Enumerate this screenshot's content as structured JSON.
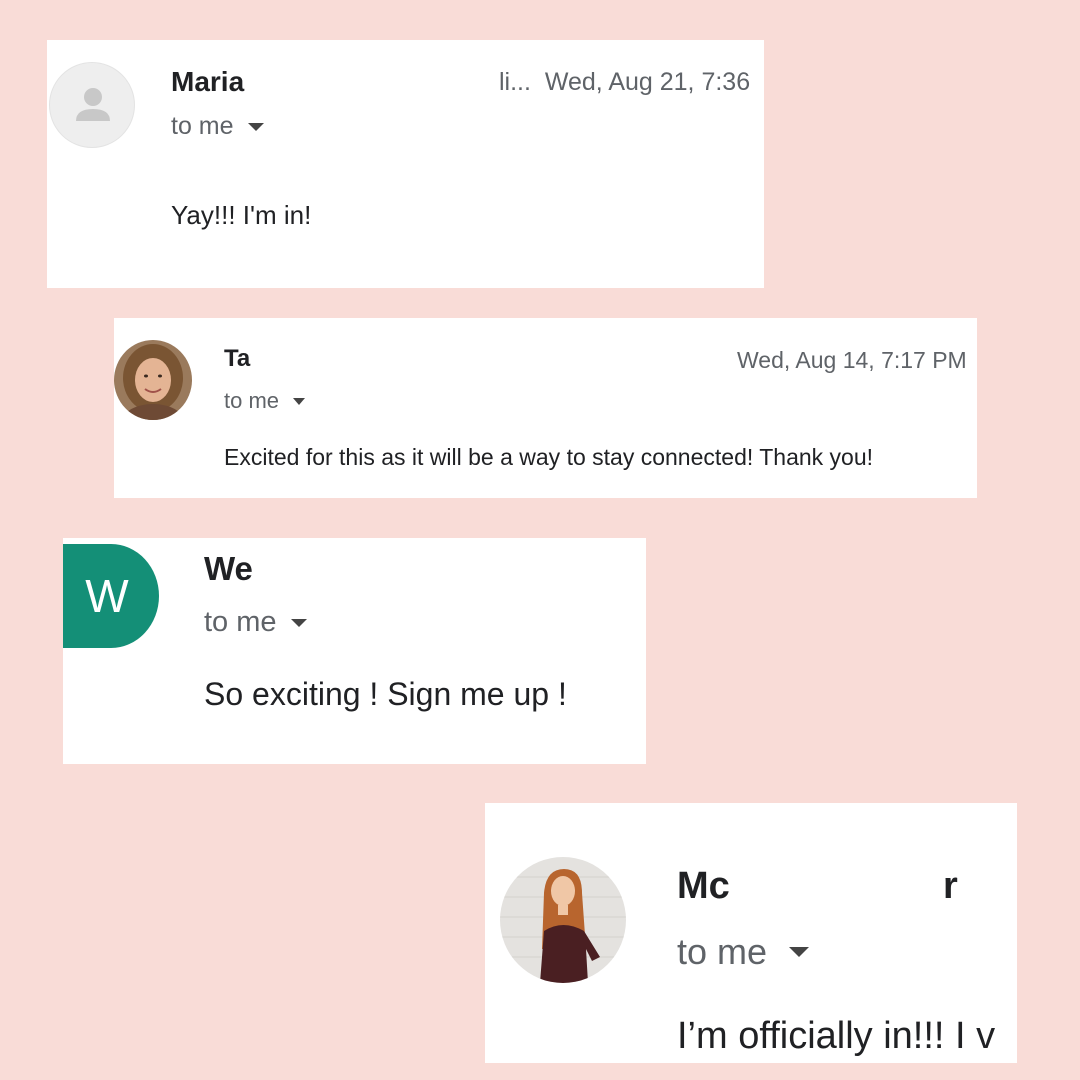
{
  "emails": [
    {
      "sender": "Maria",
      "recipient": "to me",
      "date_prefix": "li...",
      "date": "Wed, Aug 21, 7:36",
      "body": "Yay!!! I'm in!",
      "avatar": "default-person-icon"
    },
    {
      "sender": "Ta",
      "recipient": "to me",
      "date": "Wed, Aug 14, 7:17 PM",
      "body": "Excited for this as it will be a way to stay connected! Thank you!",
      "avatar": "photo-avatar"
    },
    {
      "sender": "We",
      "recipient": "to me",
      "body": "So exciting ! Sign me up !",
      "avatar_letter": "W",
      "avatar_color": "#148f77"
    },
    {
      "sender": "Mc",
      "sender_tail": "r",
      "recipient": "to me",
      "body": "I’m officially  in!!! I v",
      "avatar": "photo-avatar"
    }
  ],
  "colors": {
    "background": "#f9dcd7",
    "card": "#ffffff",
    "secondary_text": "#5f6368"
  }
}
